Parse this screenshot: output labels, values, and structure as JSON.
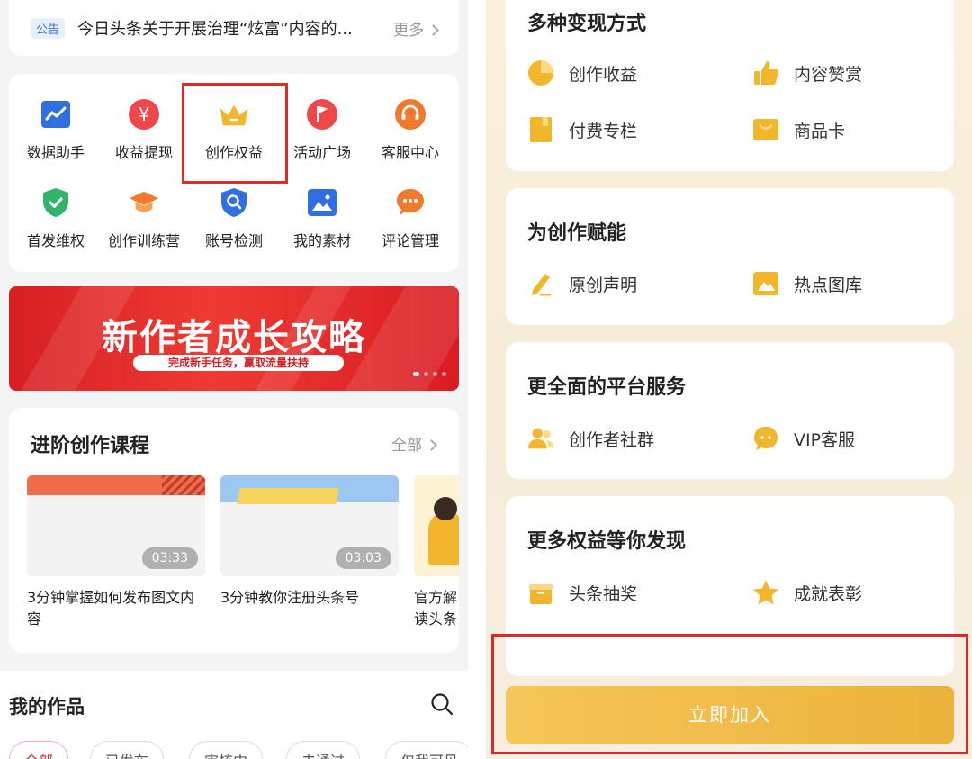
{
  "notice": {
    "tag": "公告",
    "text": "今日头条关于开展治理“炫富”内容的...",
    "more": "更多"
  },
  "tools": [
    {
      "label": "数据助手",
      "icon": "chart-icon",
      "color": "#2f6fe0"
    },
    {
      "label": "收益提现",
      "icon": "yuan-icon",
      "color": "#f04848"
    },
    {
      "label": "创作权益",
      "icon": "crown-icon",
      "color": "#f2b62c"
    },
    {
      "label": "活动广场",
      "icon": "flag-icon",
      "color": "#f04848"
    },
    {
      "label": "客服中心",
      "icon": "headset-icon",
      "color": "#f07a2c"
    },
    {
      "label": "首发维权",
      "icon": "shield-icon",
      "color": "#2fb46a"
    },
    {
      "label": "创作训练营",
      "icon": "graduation-cap-icon",
      "color": "#f07a2c"
    },
    {
      "label": "账号检测",
      "icon": "search-badge-icon",
      "color": "#2f6fe0"
    },
    {
      "label": "我的素材",
      "icon": "image-icon",
      "color": "#2f6fe0"
    },
    {
      "label": "评论管理",
      "icon": "comment-icon",
      "color": "#f07a2c"
    }
  ],
  "banner": {
    "title": "新作者成长攻略",
    "subtitle": "完成新手任务，赢取流量扶持"
  },
  "courses": {
    "title": "进阶创作课程",
    "more": "全部",
    "items": [
      {
        "title": "3分钟掌握如何发布图文内容",
        "duration": "03:33"
      },
      {
        "title": "3分钟教你注册头条号",
        "duration": "03:03"
      },
      {
        "title": "官方解读头条推",
        "duration": ""
      }
    ]
  },
  "works": {
    "title": "我的作品",
    "tabs": [
      "全部",
      "已发布",
      "审核中",
      "未通过",
      "仅我可见"
    ]
  },
  "right": {
    "sections": [
      {
        "title": "多种变现方式",
        "items": [
          {
            "label": "创作收益",
            "icon": "pie-chart-icon"
          },
          {
            "label": "内容赞赏",
            "icon": "thumbs-up-icon"
          },
          {
            "label": "付费专栏",
            "icon": "book-icon"
          },
          {
            "label": "商品卡",
            "icon": "shopping-card-icon"
          }
        ]
      },
      {
        "title": "为创作赋能",
        "items": [
          {
            "label": "原创声明",
            "icon": "pen-icon"
          },
          {
            "label": "热点图库",
            "icon": "image-icon"
          }
        ]
      },
      {
        "title": "更全面的平台服务",
        "items": [
          {
            "label": "创作者社群",
            "icon": "people-icon"
          },
          {
            "label": "VIP客服",
            "icon": "chat-bubble-icon"
          }
        ]
      },
      {
        "title": "更多权益等你发现",
        "items": [
          {
            "label": "头条抽奖",
            "icon": "gift-box-icon"
          },
          {
            "label": "成就表彰",
            "icon": "star-icon"
          }
        ]
      }
    ],
    "join_label": "立即加入"
  },
  "colors": {
    "accent_red": "#e02a2a",
    "gold": "#f2b62c",
    "banner_red": "#d61f24"
  }
}
